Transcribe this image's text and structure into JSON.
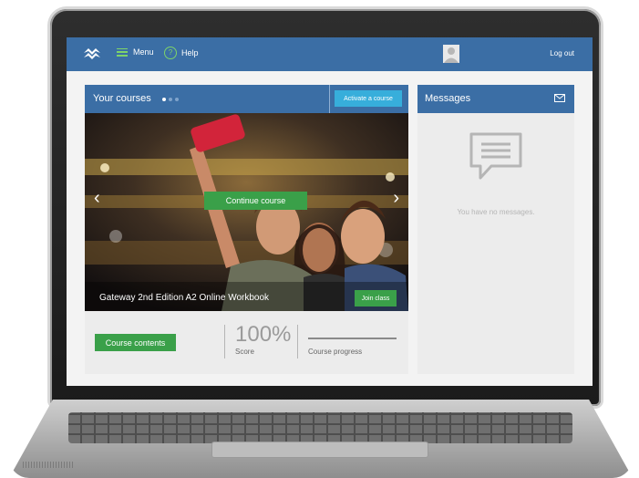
{
  "header": {
    "menu_label": "Menu",
    "help_label": "Help",
    "help_glyph": "?",
    "logout_label": "Log out"
  },
  "courses": {
    "title": "Your courses",
    "activate_label": "Activate a course",
    "continue_label": "Continue course",
    "course_name": "Gateway 2nd Edition  A2 Online Workbook",
    "join_label": "Join class",
    "contents_label": "Course contents",
    "score_value": "100%",
    "score_label": "Score",
    "progress_label": "Course progress",
    "progress_fraction": 1.0,
    "carousel_dots": 3,
    "active_dot": 0
  },
  "messages": {
    "title": "Messages",
    "empty_text": "You have no messages."
  },
  "icons": {
    "prev": "‹",
    "next": "›"
  },
  "colors": {
    "brand_blue": "#3b6ea5",
    "action_green": "#3aa049",
    "activate_blue": "#37aedb"
  }
}
